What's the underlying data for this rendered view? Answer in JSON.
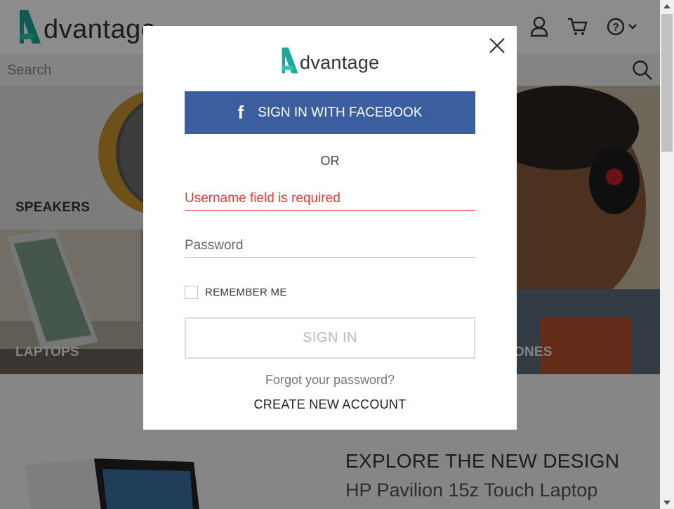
{
  "brand": {
    "logo_text": "dvantage"
  },
  "header": {
    "user_icon": "user-icon",
    "cart_icon": "cart-icon",
    "help_icon": "help-icon"
  },
  "search": {
    "placeholder": "Search"
  },
  "categories": [
    {
      "label": "SPEAKERS"
    },
    {
      "label": "LAPTOPS"
    },
    {
      "label": "ONES"
    }
  ],
  "promo": {
    "title": "EXPLORE THE NEW DESIGN",
    "subtitle": "HP Pavilion 15z Touch Laptop"
  },
  "modal": {
    "logo_text": "dvantage",
    "facebook_label": "SIGN IN WITH FACEBOOK",
    "facebook_icon": "f",
    "or_text": "OR",
    "username_error": "Username field is required",
    "password_placeholder": "Password",
    "remember_label": "REMEMBER ME",
    "remember_checked": false,
    "signin_label": "SIGN IN",
    "forgot_label": "Forgot your password?",
    "create_label": "CREATE NEW ACCOUNT"
  },
  "colors": {
    "accent_teal": "#1ba79a",
    "facebook_blue": "#3b5e9f",
    "error_red": "#ec3838"
  }
}
